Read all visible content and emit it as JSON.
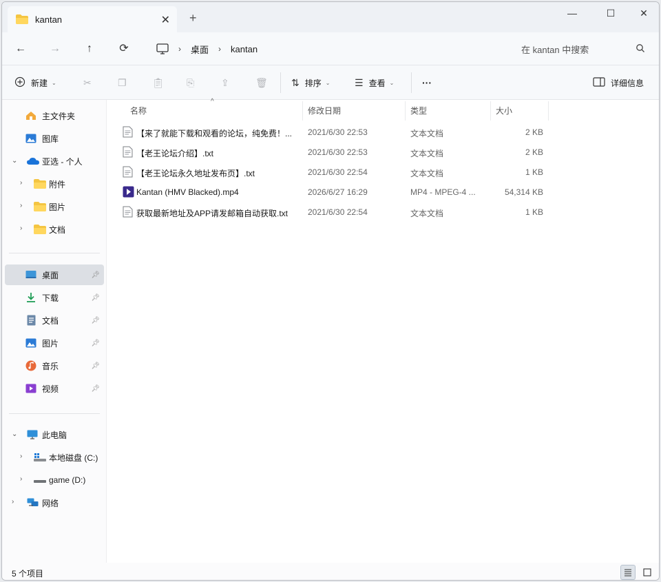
{
  "tab": {
    "title": "kantan"
  },
  "window": {
    "minimize": "—",
    "maximize": "☐",
    "close": "✕"
  },
  "address": {
    "crumbs": [
      "桌面",
      "kantan"
    ]
  },
  "search": {
    "placeholder": "在 kantan 中搜索"
  },
  "toolbar": {
    "new_label": "新建",
    "sort_label": "排序",
    "view_label": "查看",
    "more_label": "···",
    "details_label": "详细信息"
  },
  "sidebar": {
    "home": "主文件夹",
    "gallery": "图库",
    "onedrive": "亚选 - 个人",
    "attachments": "附件",
    "pictures_od": "图片",
    "documents_od": "文档",
    "desktop": "桌面",
    "downloads": "下载",
    "documents": "文档",
    "pictures": "图片",
    "music": "音乐",
    "videos": "视频",
    "this_pc": "此电脑",
    "local_c": "本地磁盘 (C:)",
    "game_d": "game (D:)",
    "network": "网络"
  },
  "columns": {
    "name": "名称",
    "date": "修改日期",
    "type": "类型",
    "size": "大小"
  },
  "files": [
    {
      "name": "【来了就能下载和观看的论坛，纯免费！...",
      "date": "2021/6/30 22:53",
      "type": "文本文档",
      "size": "2 KB",
      "icon": "text-file-icon"
    },
    {
      "name": "【老王论坛介绍】.txt",
      "date": "2021/6/30 22:53",
      "type": "文本文档",
      "size": "2 KB",
      "icon": "text-file-icon"
    },
    {
      "name": "【老王论坛永久地址发布页】.txt",
      "date": "2021/6/30 22:54",
      "type": "文本文档",
      "size": "1 KB",
      "icon": "text-file-icon"
    },
    {
      "name": "Kantan (HMV Blacked).mp4",
      "date": "2026/6/27 16:29",
      "type": "MP4 - MPEG-4 ...",
      "size": "54,314 KB",
      "icon": "video-file-icon"
    },
    {
      "name": "获取最新地址及APP请发邮箱自动获取.txt",
      "date": "2021/6/30 22:54",
      "type": "文本文档",
      "size": "1 KB",
      "icon": "text-file-icon"
    }
  ],
  "status": {
    "count": "5 个项目"
  },
  "colors": {
    "accent": "#0067c0",
    "folder": "#f4c542",
    "selected": "#dcdfe4"
  }
}
